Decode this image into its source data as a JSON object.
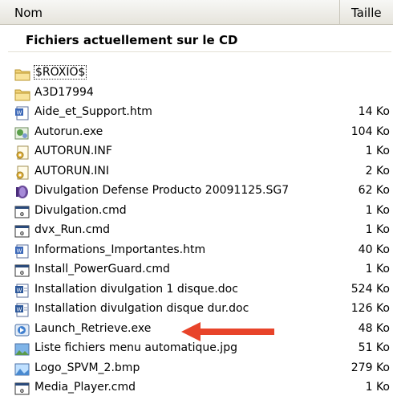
{
  "columns": {
    "name": "Nom",
    "size": "Taille"
  },
  "group": {
    "title": "Fichiers actuellement sur le CD"
  },
  "files": [
    {
      "name": "$ROXIO$",
      "size": "",
      "icon": "folder-icon"
    },
    {
      "name": "A3D17994",
      "size": "",
      "icon": "folder-icon"
    },
    {
      "name": "Aide_et_Support.htm",
      "size": "14 Ko",
      "icon": "htm-file-icon"
    },
    {
      "name": "Autorun.exe",
      "size": "104 Ko",
      "icon": "exe-file-icon"
    },
    {
      "name": "AUTORUN.INF",
      "size": "1 Ko",
      "icon": "config-file-icon"
    },
    {
      "name": "AUTORUN.INI",
      "size": "2 Ko",
      "icon": "config-file-icon"
    },
    {
      "name": "Divulgation Defense Producto 20091125.SG7",
      "size": "62 Ko",
      "icon": "sg7-file-icon"
    },
    {
      "name": "Divulgation.cmd",
      "size": "1 Ko",
      "icon": "cmd-file-icon"
    },
    {
      "name": "dvx_Run.cmd",
      "size": "1 Ko",
      "icon": "cmd-file-icon"
    },
    {
      "name": "Informations_Importantes.htm",
      "size": "40 Ko",
      "icon": "htm-file-icon"
    },
    {
      "name": "Install_PowerGuard.cmd",
      "size": "1 Ko",
      "icon": "cmd-file-icon"
    },
    {
      "name": "Installation divulgation 1 disque.doc",
      "size": "524 Ko",
      "icon": "doc-file-icon"
    },
    {
      "name": "Installation divulgation disque dur.doc",
      "size": "126 Ko",
      "icon": "doc-file-icon"
    },
    {
      "name": "Launch_Retrieve.exe",
      "size": "48 Ko",
      "icon": "launch-exe-icon"
    },
    {
      "name": "Liste fichiers menu automatique.jpg",
      "size": "51 Ko",
      "icon": "jpg-file-icon"
    },
    {
      "name": "Logo_SPVM_2.bmp",
      "size": "279 Ko",
      "icon": "bmp-file-icon"
    },
    {
      "name": "Media_Player.cmd",
      "size": "1 Ko",
      "icon": "cmd-file-icon"
    }
  ],
  "annotation": {
    "target": "Launch_Retrieve.exe",
    "color": "#e8442a"
  },
  "colors": {
    "header_bg": "#ebe9e1",
    "folder": "#f2d37a",
    "arrow": "#e8442a"
  }
}
